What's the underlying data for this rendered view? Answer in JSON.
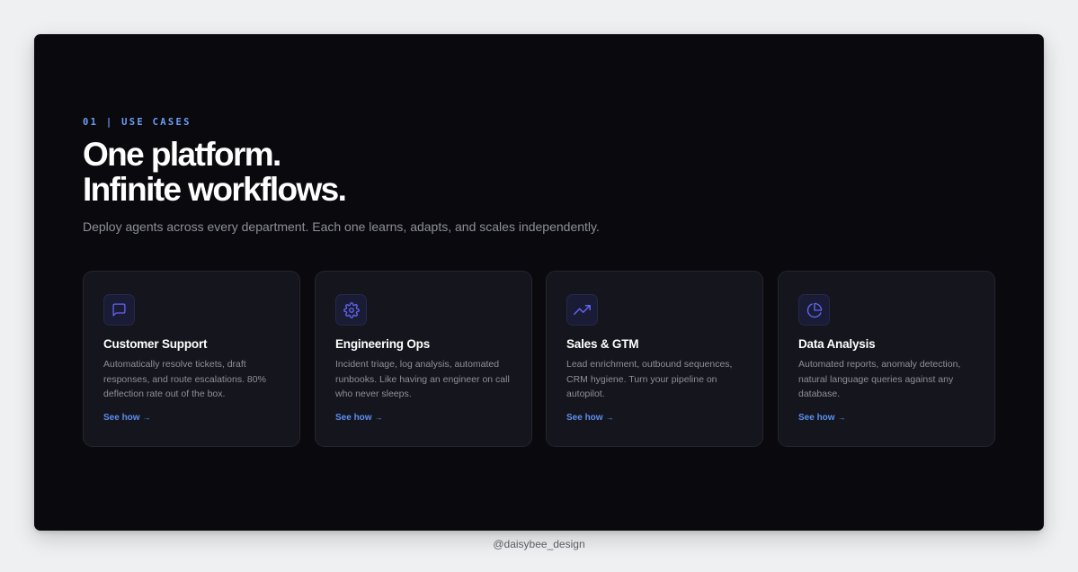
{
  "section": {
    "eyebrow": "01 | USE CASES",
    "headline_line1": "One platform.",
    "headline_line2": "Infinite workflows.",
    "subtitle": "Deploy agents across every department. Each one learns, adapts, and scales independently."
  },
  "colors": {
    "background": "#0a0a0e",
    "card": "#14151d",
    "accent": "#6d9cf5",
    "icon": "#6366f1"
  },
  "cards": [
    {
      "icon": "message-square-icon",
      "title": "Customer Support",
      "description": "Automatically resolve tickets, draft responses, and route escalations. 80% deflection rate out of the box.",
      "link_label": "See how",
      "link_arrow": "→"
    },
    {
      "icon": "gear-icon",
      "title": "Engineering Ops",
      "description": "Incident triage, log analysis, automated runbooks. Like having an engineer on call who never sleeps.",
      "link_label": "See how",
      "link_arrow": "→"
    },
    {
      "icon": "trending-up-icon",
      "title": "Sales & GTM",
      "description": "Lead enrichment, outbound sequences, CRM hygiene. Turn your pipeline on autopilot.",
      "link_label": "See how",
      "link_arrow": "→"
    },
    {
      "icon": "pie-chart-icon",
      "title": "Data Analysis",
      "description": "Automated reports, anomaly detection, natural language queries against any database.",
      "link_label": "See how",
      "link_arrow": "→"
    }
  ],
  "footer": {
    "credit": "@daisybee_design"
  }
}
